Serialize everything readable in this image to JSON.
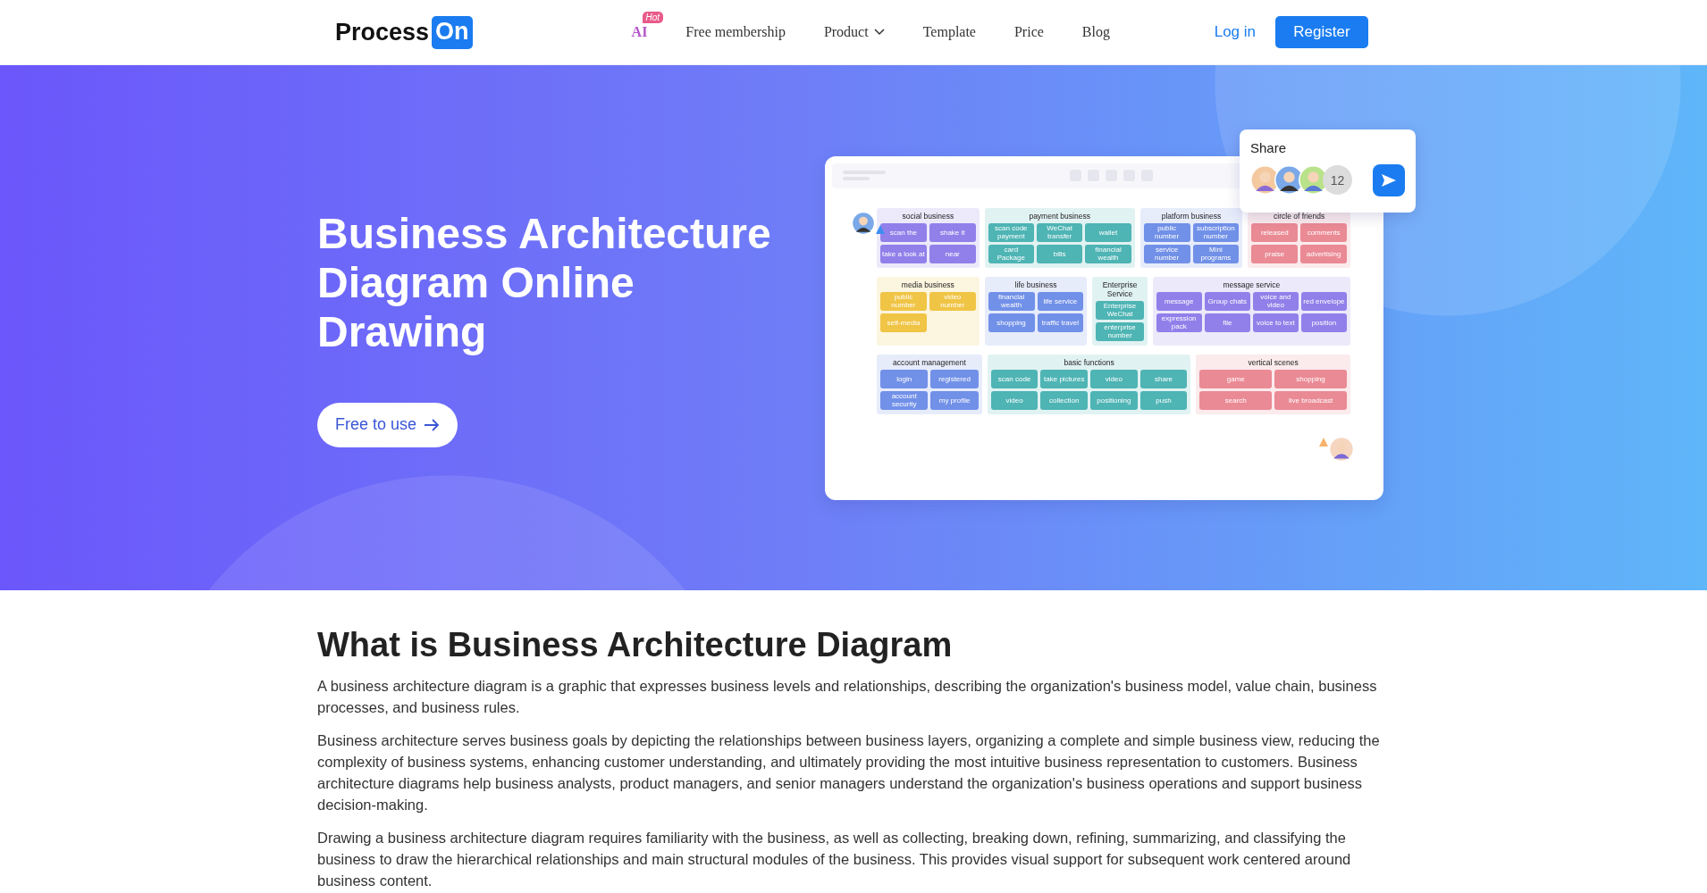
{
  "nav": {
    "logo": {
      "text": "Process",
      "badge": "On"
    },
    "links": [
      {
        "label": "AI",
        "kind": "ai",
        "badge": "Hot"
      },
      {
        "label": "Free membership",
        "kind": "link"
      },
      {
        "label": "Product",
        "kind": "dropdown"
      },
      {
        "label": "Template",
        "kind": "link"
      },
      {
        "label": "Price",
        "kind": "link"
      },
      {
        "label": "Blog",
        "kind": "link"
      }
    ],
    "login": "Log in",
    "register": "Register"
  },
  "hero": {
    "title": "Business Architecture Diagram Online Drawing",
    "cta": "Free to use",
    "share": {
      "title": "Share",
      "count": "12"
    },
    "diagram": {
      "lanes": [
        {
          "groups": [
            {
              "title": "social business",
              "color": "#9180ea",
              "items": [
                "scan the",
                "shake it",
                "take a look at",
                "near"
              ]
            },
            {
              "title": "payment business",
              "color": "#4eb4b4",
              "items": [
                "scan code payment",
                "WeChat transfer",
                "wallet",
                "card Package",
                "bills",
                "financial wealth"
              ]
            },
            {
              "title": "platform business",
              "color": "#7190e8",
              "items": [
                "public number",
                "subscription number",
                "service number",
                "Mini programs"
              ]
            },
            {
              "title": "circle of friends",
              "color": "#ea8a94",
              "items": [
                "released",
                "comments",
                "praise",
                "advertising"
              ]
            }
          ]
        },
        {
          "groups": [
            {
              "title": "media business",
              "color": "#f0c445",
              "items": [
                "public number",
                "video number",
                "self-media"
              ]
            },
            {
              "title": "life business",
              "color": "#7190e8",
              "items": [
                "financial wealth",
                "life service",
                "shopping",
                "traffic travel"
              ]
            },
            {
              "title": "Enterprise Service",
              "color": "#4eb4b4",
              "items": [
                "Enterprise WeChat",
                "enterprise number"
              ]
            },
            {
              "title": "message service",
              "color": "#9180ea",
              "items": [
                "message",
                "Group chats",
                "voice and video",
                "red envelope",
                "expression pack",
                "file",
                "voice to text",
                "position"
              ]
            }
          ]
        },
        {
          "groups": [
            {
              "title": "account management",
              "color": "#7190e8",
              "items": [
                "login",
                "registered",
                "account security",
                "my profile"
              ]
            },
            {
              "title": "basic functions",
              "color": "#4eb4b4",
              "items": [
                "scan code",
                "take pictures",
                "video",
                "share",
                "video",
                "collection",
                "positioning",
                "push"
              ]
            },
            {
              "title": "vertical scenes",
              "color": "#ea8a94",
              "items": [
                "game",
                "shopping",
                "search",
                "live broadcast"
              ]
            }
          ]
        }
      ]
    }
  },
  "article": {
    "heading": "What is Business Architecture Diagram",
    "paragraphs": [
      "A business architecture diagram is a graphic that expresses business levels and relationships, describing the organization's business model, value chain, business processes, and business rules.",
      "Business architecture serves business goals by depicting the relationships between business layers, organizing a complete and simple business view, reducing the complexity of business systems, enhancing customer understanding, and ultimately providing the most intuitive business representation to customers. Business architecture diagrams help business analysts, product managers, and senior managers understand the organization's business operations and support business decision-making.",
      "Drawing a business architecture diagram requires familiarity with the business, as well as collecting, breaking down, refining, summarizing, and classifying the business to draw the hierarchical relationships and main structural modules of the business. This provides visual support for subsequent work centered around business content."
    ]
  }
}
